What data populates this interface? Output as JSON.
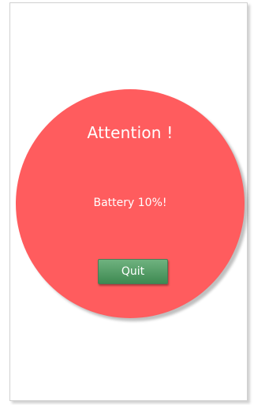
{
  "dialog": {
    "title": "Attention !",
    "message": "Battery 10%!",
    "quit_label": "Quit"
  },
  "colors": {
    "circle": "#FF5C5E",
    "button_top": "#6FB27F",
    "button_bottom": "#3E8A52"
  }
}
